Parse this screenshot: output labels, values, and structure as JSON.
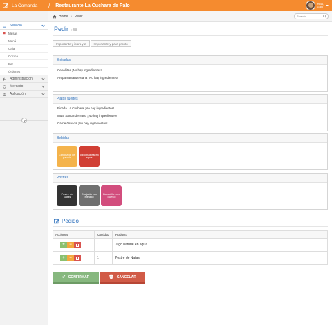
{
  "navbar": {
    "brand": "La Comanda",
    "separator": "/",
    "restaurant": "Restaurante La Cuchara de Palo",
    "user_greeting": "Hola,",
    "user_name": "Galo"
  },
  "sidebar": {
    "sections": [
      {
        "label": "Servicio",
        "icon": "dashboard-icon",
        "active": true
      },
      {
        "label": "Administración",
        "icon": "wrench-icon"
      },
      {
        "label": "Mercado",
        "icon": "circle-icon"
      },
      {
        "label": "Aplicación",
        "icon": "power-icon"
      }
    ],
    "servicio_items": [
      "Mesas",
      "Menú",
      "Caja",
      "Cocina",
      "Bar",
      "Órdenes"
    ]
  },
  "breadcrumb": {
    "home": "Home",
    "current": "Pedir"
  },
  "search": {
    "placeholder": "Search ..."
  },
  "page": {
    "title": "Pedir",
    "subtitle": "» 58"
  },
  "tabs": [
    "Importante y ipara ya!",
    "Importante y para pronto"
  ],
  "panels": {
    "entradas": {
      "title": "Entradas",
      "items": [
        "Cebollitas ¡No hay ingredientes!",
        "Arepa santandereana ¡No hay ingredientes!"
      ]
    },
    "platos_fuertes": {
      "title": "Platos fuertes",
      "items": [
        "Picada La Cuchara ¡No hay ingredientes!",
        "Mute Santandereano ¡No hay ingredientes!",
        "Carne Oreada ¡No hay ingredientes!"
      ]
    },
    "bebidas": {
      "title": "Bebidas",
      "tiles": [
        {
          "label": "Limonada de panela",
          "color": "#f4b34b"
        },
        {
          "label": "Jugo natural en agua",
          "color": "#d13f34"
        }
      ]
    },
    "postres": {
      "title": "Postres",
      "tiles": [
        {
          "label": "Postre de Natas",
          "color": "#333333"
        },
        {
          "label": "Cuajada con Melado",
          "color": "#6f6f6f"
        },
        {
          "label": "Bocadillo con queso",
          "color": "#d24d7d"
        }
      ]
    }
  },
  "pedido": {
    "title": "Pedido",
    "columns": [
      "Acciones",
      "Cantidad",
      "Producto"
    ],
    "rows": [
      {
        "cantidad": "1",
        "producto": "Jugo natural en agua"
      },
      {
        "cantidad": "1",
        "producto": "Postre de Natas"
      }
    ]
  },
  "buttons": {
    "confirm": "CONFIRMAR",
    "cancel": "CANCELAR"
  },
  "colors": {
    "primary": "#f58b2f",
    "link": "#2a6ebb",
    "success": "#87b87f",
    "danger": "#d15b47"
  }
}
